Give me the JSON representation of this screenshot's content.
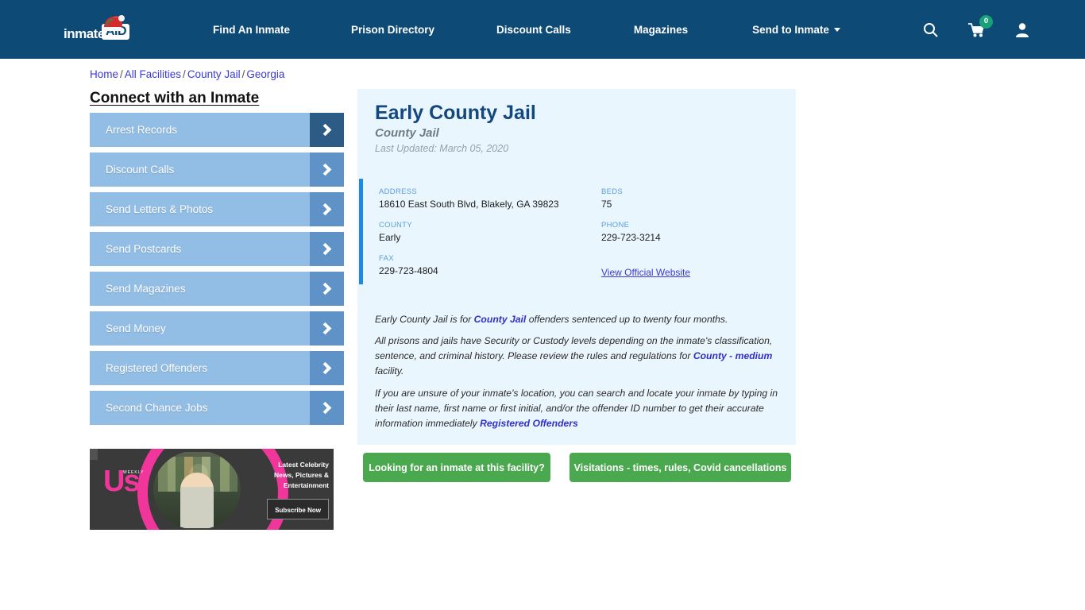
{
  "nav": {
    "logo": {
      "text_primary": "inmate",
      "text_secondary": "AID",
      "hat_icon": "santa-hat-icon"
    },
    "links": [
      {
        "label": "Find An Inmate"
      },
      {
        "label": "Prison Directory"
      },
      {
        "label": "Discount Calls"
      },
      {
        "label": "Magazines"
      },
      {
        "label": "Send to Inmate"
      }
    ],
    "icons": {
      "search": "search-icon",
      "cart": "shopping-cart-icon",
      "cart_count": "0",
      "account": "user-account-icon"
    },
    "background_color": "#0d4a76"
  },
  "breadcrumb": {
    "items": [
      "Home",
      "All Facilities",
      "County Jail",
      "Georgia"
    ],
    "separator": "/"
  },
  "sidebar": {
    "title": "Connect with an Inmate",
    "items": [
      {
        "label": "Arrest Records"
      },
      {
        "label": "Discount Calls"
      },
      {
        "label": "Send Letters & Photos"
      },
      {
        "label": "Send Postcards"
      },
      {
        "label": "Send Magazines"
      },
      {
        "label": "Send Money"
      },
      {
        "label": "Registered Offenders"
      },
      {
        "label": "Second Chance Jobs"
      }
    ],
    "item_color": "#92bde4",
    "arrow_color": "#5f92c6",
    "arrow_color_active": "#2c5c85"
  },
  "ad": {
    "brand": "Us",
    "brand_sub": "WEEKLY",
    "line1": "Latest Celebrity",
    "line2": "News, Pictures &",
    "line3": "Entertainment",
    "button": "Subscribe Now"
  },
  "facility": {
    "name": "Early County Jail",
    "type": "County Jail",
    "last_updated": "Last Updated: March 05, 2020",
    "fields": {
      "address_label": "ADDRESS",
      "address_value": "18610 East South Blvd, Blakely, GA 39823",
      "beds_label": "BEDS",
      "beds_value": "75",
      "county_label": "COUNTY",
      "county_value": "Early",
      "phone_label": "PHONE",
      "phone_value": "229-723-3214",
      "fax_label": "FAX",
      "fax_value": "229-723-4804",
      "website_link": "View Official Website"
    },
    "paragraph1": {
      "part1": "Early County Jail is for ",
      "link1": "County Jail",
      "part2": " offenders sentenced up to twenty four months."
    },
    "paragraph2": {
      "part1": "All prisons and jails have Security or Custody levels depending on the inmate's classification, sentence, and criminal history. Please review the rules and regulations for ",
      "link1": "County - medium",
      "part2": " facility."
    },
    "paragraph3": {
      "part1": "If you are unsure of your inmate's location, you can search and locate your inmate by typing in their last name, first name or first initial, and/or the offender ID number to get their accurate information immediately ",
      "link1": "Registered Offenders"
    },
    "panel_color": "#eaf6fd",
    "accent_color": "#1e88e5"
  },
  "cta_buttons": [
    {
      "label": "Looking for an inmate at this facility?"
    },
    {
      "label": "Visitations - times, rules, Covid cancellations"
    }
  ]
}
